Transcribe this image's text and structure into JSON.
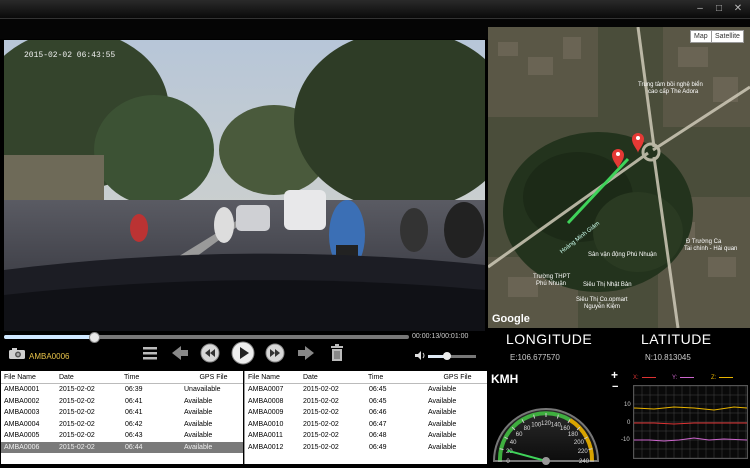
{
  "video": {
    "timestamp": "2015-02-02  06:43:55"
  },
  "player": {
    "filename": "AMBA0006",
    "timecode": "00:00:13/00:01:00",
    "progress": 0.22,
    "volume": 0.4
  },
  "map": {
    "toggle": [
      "Map",
      "Satellite"
    ],
    "attribution": "Google",
    "labels": [
      "Trung tâm bồi nghệ biển",
      "cao cấp The Adora",
      "Trường THPT",
      "Phú Nhuận",
      "Sân vận động Phú Nhuận",
      "Siêu Thị Nhật Bản",
      "Siêu Thị Co.opmart",
      "Nguyễn Kiệm",
      "Đ Trường Ca",
      "Tai chính - Hải quan",
      "Hoàng Minh Giám"
    ]
  },
  "coords": {
    "longitude_label": "LONGITUDE",
    "latitude_label": "LATITUDE",
    "longitude": "E:106.677570",
    "latitude": "N:10.813045"
  },
  "tables": {
    "headers": [
      "File Name",
      "Date",
      "Time",
      "GPS File"
    ],
    "left": [
      [
        "AMBA0001",
        "2015-02-02",
        "06:39",
        "Unavailable"
      ],
      [
        "AMBA0002",
        "2015-02-02",
        "06:41",
        "Available"
      ],
      [
        "AMBA0003",
        "2015-02-02",
        "06:41",
        "Available"
      ],
      [
        "AMBA0004",
        "2015-02-02",
        "06:42",
        "Available"
      ],
      [
        "AMBA0005",
        "2015-02-02",
        "06:43",
        "Available"
      ],
      [
        "AMBA0006",
        "2015-02-02",
        "06:44",
        "Available"
      ]
    ],
    "right": [
      [
        "AMBA0007",
        "2015-02-02",
        "06:45",
        "Available"
      ],
      [
        "AMBA0008",
        "2015-02-02",
        "06:45",
        "Available"
      ],
      [
        "AMBA0009",
        "2015-02-02",
        "06:46",
        "Available"
      ],
      [
        "AMBA0010",
        "2015-02-02",
        "06:47",
        "Available"
      ],
      [
        "AMBA0011",
        "2015-02-02",
        "06:48",
        "Available"
      ],
      [
        "AMBA0012",
        "2015-02-02",
        "06:49",
        "Available"
      ]
    ],
    "selected_left_row": 5
  },
  "speed": {
    "unit": "KMH",
    "ticks": [
      "0",
      "20",
      "40",
      "60",
      "80",
      "100",
      "120",
      "140",
      "160",
      "180",
      "200",
      "220",
      "240"
    ],
    "value": 20
  },
  "gsensor": {
    "legend": [
      "X:",
      "Y:",
      "Z:"
    ],
    "legend_colors": [
      "#d33",
      "#c6c",
      "#e8b400"
    ],
    "y_ticks": [
      "10",
      "0",
      "-10"
    ],
    "zoom_in": "+",
    "zoom_out": "−"
  },
  "colors": {
    "accent": "#e8c34a",
    "route": "#3fd35a",
    "pin": "#e53935"
  }
}
